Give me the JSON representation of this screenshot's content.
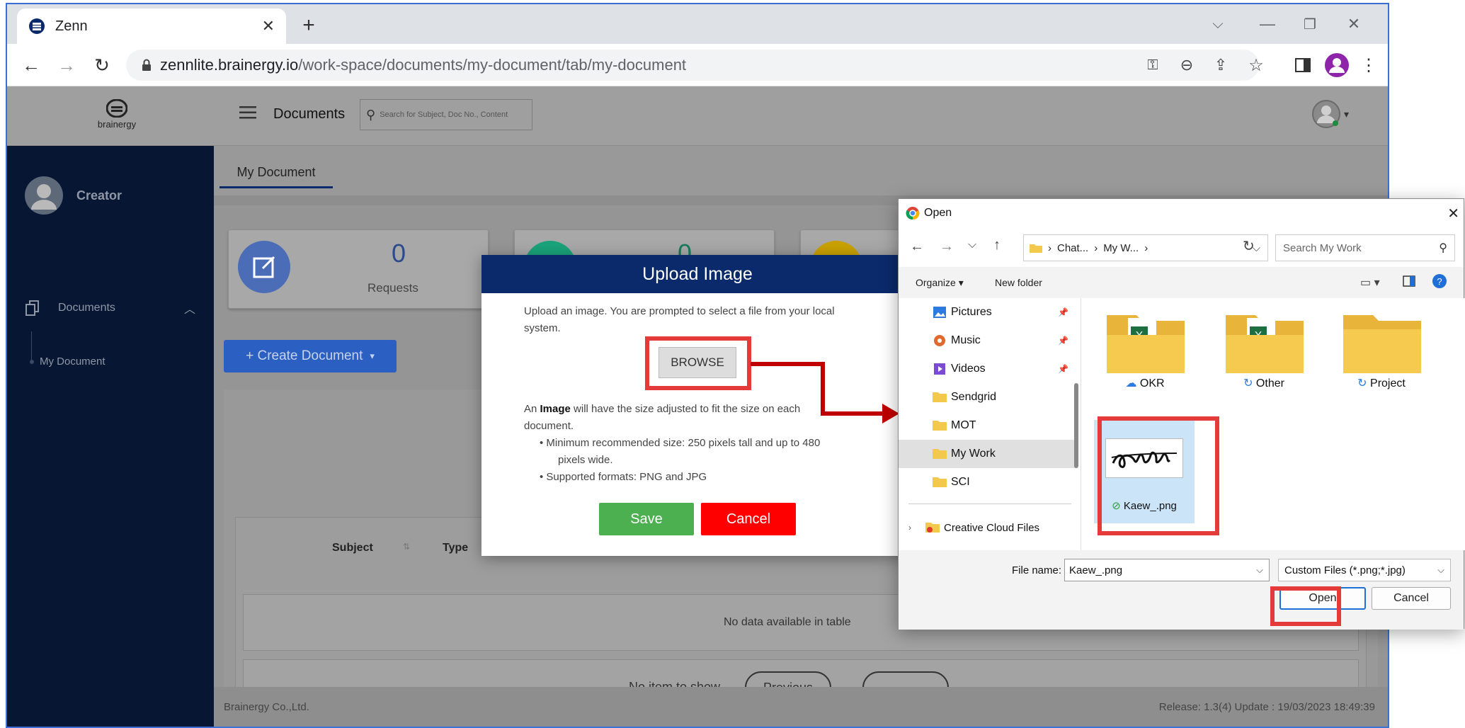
{
  "browser": {
    "tab_title": "Zenn",
    "url_host": "zennlite.brainergy.io",
    "url_path": "/work-space/documents/my-document/tab/my-document"
  },
  "app": {
    "logo_text": "brainergy",
    "section_title": "Documents",
    "search_placeholder": "Search for Subject, Doc No., Content",
    "user_role": "Creator",
    "sidebar": {
      "documents_label": "Documents",
      "my_document_label": "My Document"
    },
    "tab_label": "My Document",
    "cards": [
      {
        "value": "0",
        "label": "Requests",
        "color": "#4b6cb7"
      },
      {
        "value": "0",
        "label": "",
        "color": "#1aa37a"
      },
      {
        "value": "",
        "label": "",
        "color": "#d4a900"
      }
    ],
    "create_button": "+ Create Document",
    "table": {
      "col_subject": "Subject",
      "col_type": "Type",
      "empty": "No data available in table"
    },
    "pager": {
      "no_item": "No item to show",
      "previous": "Previous"
    },
    "footer": {
      "company": "Brainergy Co.,Ltd.",
      "release": "Release: 1.3(4) Update : 19/03/2023 18:49:39"
    }
  },
  "modal": {
    "title": "Upload Image",
    "intro_line1": "Upload an image. You are prompted to select a file from your local",
    "intro_line2": "system.",
    "browse": "BROWSE",
    "info_prefix": "An ",
    "info_bold": "Image",
    "info_rest": " will have the size adjusted to fit the size on each",
    "info_line2": "document.",
    "bullet1_line1": "Minimum recommended size: 250 pixels tall and up to 480",
    "bullet1_line2": "pixels wide.",
    "bullet2": "Supported formats: PNG and JPG",
    "save": "Save",
    "cancel": "Cancel"
  },
  "dialog": {
    "title": "Open",
    "crumbs": [
      "Chat...",
      "My W...",
      ""
    ],
    "search_placeholder": "Search My Work",
    "organize": "Organize",
    "new_folder": "New folder",
    "nav": [
      "Pictures",
      "Music",
      "Videos",
      "Sendgrid",
      "MOT",
      "My Work",
      "SCI"
    ],
    "cloud_item": "Creative Cloud Files",
    "folders": [
      "OKR",
      "Other",
      "Project"
    ],
    "file": "Kaew_.png",
    "filename_label": "File name:",
    "filename_value": "Kaew_.png",
    "filetype": "Custom Files (*.png;*.jpg)",
    "open": "Open",
    "cancel": "Cancel"
  }
}
